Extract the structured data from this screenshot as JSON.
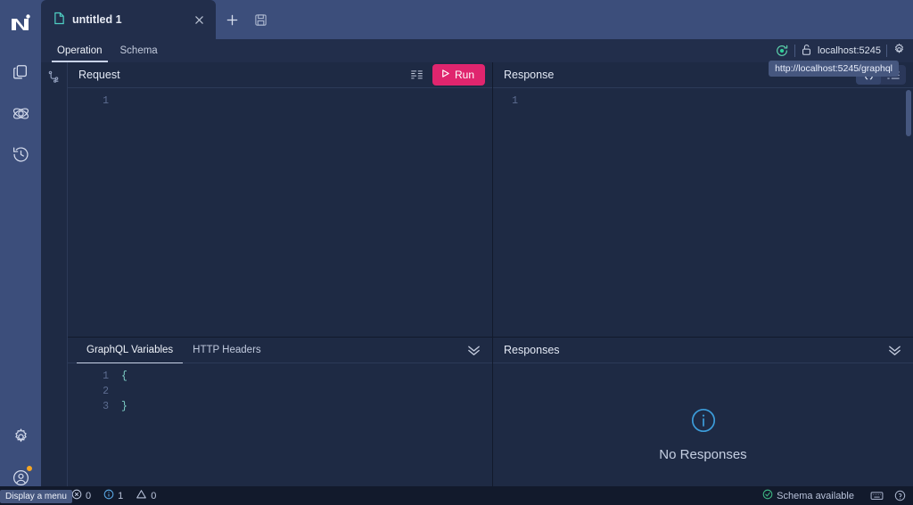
{
  "app": {
    "name": "nitro-graphql-ide",
    "colors": {
      "rail": "#3c4e7b",
      "panel": "#1e2a44",
      "accent_run": "#e0256e",
      "tab_active": "#222e4b",
      "status_bar": "#121a2c",
      "ok_green": "#3fb984",
      "info_blue": "#3c9ddb",
      "badge_orange": "#f5a623",
      "tab_icon_teal": "#4fd0c4"
    }
  },
  "rail": {
    "logo": "nitro-logo-icon",
    "items": [
      {
        "name": "documents-icon",
        "tooltip": "Documents"
      },
      {
        "name": "schema-atom-icon",
        "tooltip": "Schema"
      },
      {
        "name": "history-icon",
        "tooltip": "History"
      }
    ],
    "bottom_items": [
      {
        "name": "settings-gear-icon",
        "tooltip": "Settings"
      },
      {
        "name": "account-icon",
        "tooltip": "Account",
        "badge": true
      }
    ]
  },
  "tabstrip": {
    "tabs": [
      {
        "label": "untitled 1",
        "icon": "document-icon",
        "active": true,
        "close": "×"
      }
    ],
    "new_tab_label": "+",
    "save_label": "save-icon"
  },
  "subtabs": {
    "items": [
      {
        "label": "Operation",
        "active": true
      },
      {
        "label": "Schema",
        "active": false
      }
    ]
  },
  "urlbar": {
    "refresh_icon": "refresh-schema-icon",
    "lock_icon": "unlocked-icon",
    "url": "localhost:5245",
    "settings_icon": "gear-icon",
    "tooltip": "http://localhost:5245/graphql"
  },
  "request": {
    "gutter_icon": "branch-flow-icon",
    "title": "Request",
    "prettify_icon": "format-document-icon",
    "run_label": "Run",
    "run_icon": "play-icon",
    "editor_lines": [
      {
        "num": "1",
        "text": ""
      }
    ]
  },
  "variables": {
    "tabs": [
      {
        "label": "GraphQL Variables",
        "active": true
      },
      {
        "label": "HTTP Headers",
        "active": false
      }
    ],
    "collapse_icon": "chevron-double-down-icon",
    "editor_lines": [
      {
        "num": "1",
        "text": "{"
      },
      {
        "num": "2",
        "text": ""
      },
      {
        "num": "3",
        "text": "}"
      }
    ]
  },
  "response": {
    "title": "Response",
    "view_buttons": [
      {
        "name": "code-view-icon",
        "label": "{ }",
        "active": true
      },
      {
        "name": "list-view-icon",
        "label": "list",
        "active": false
      }
    ],
    "editor_lines": [
      {
        "num": "1",
        "text": ""
      }
    ]
  },
  "responses": {
    "title": "Responses",
    "collapse_icon": "chevron-double-down-icon",
    "empty_icon": "info-circle-icon",
    "empty_label": "No Responses"
  },
  "statusbar": {
    "menu_tooltip": "Display a menu",
    "errors_icon": "error-circle-icon",
    "errors_count": "0",
    "info_icon": "info-circle-icon",
    "info_count": "1",
    "warnings_icon": "warning-triangle-icon",
    "warnings_count": "0",
    "schema_status_icon": "check-circle-icon",
    "schema_status": "Schema available",
    "keyboard_icon": "keyboard-icon",
    "help_icon": "help-circle-icon"
  }
}
